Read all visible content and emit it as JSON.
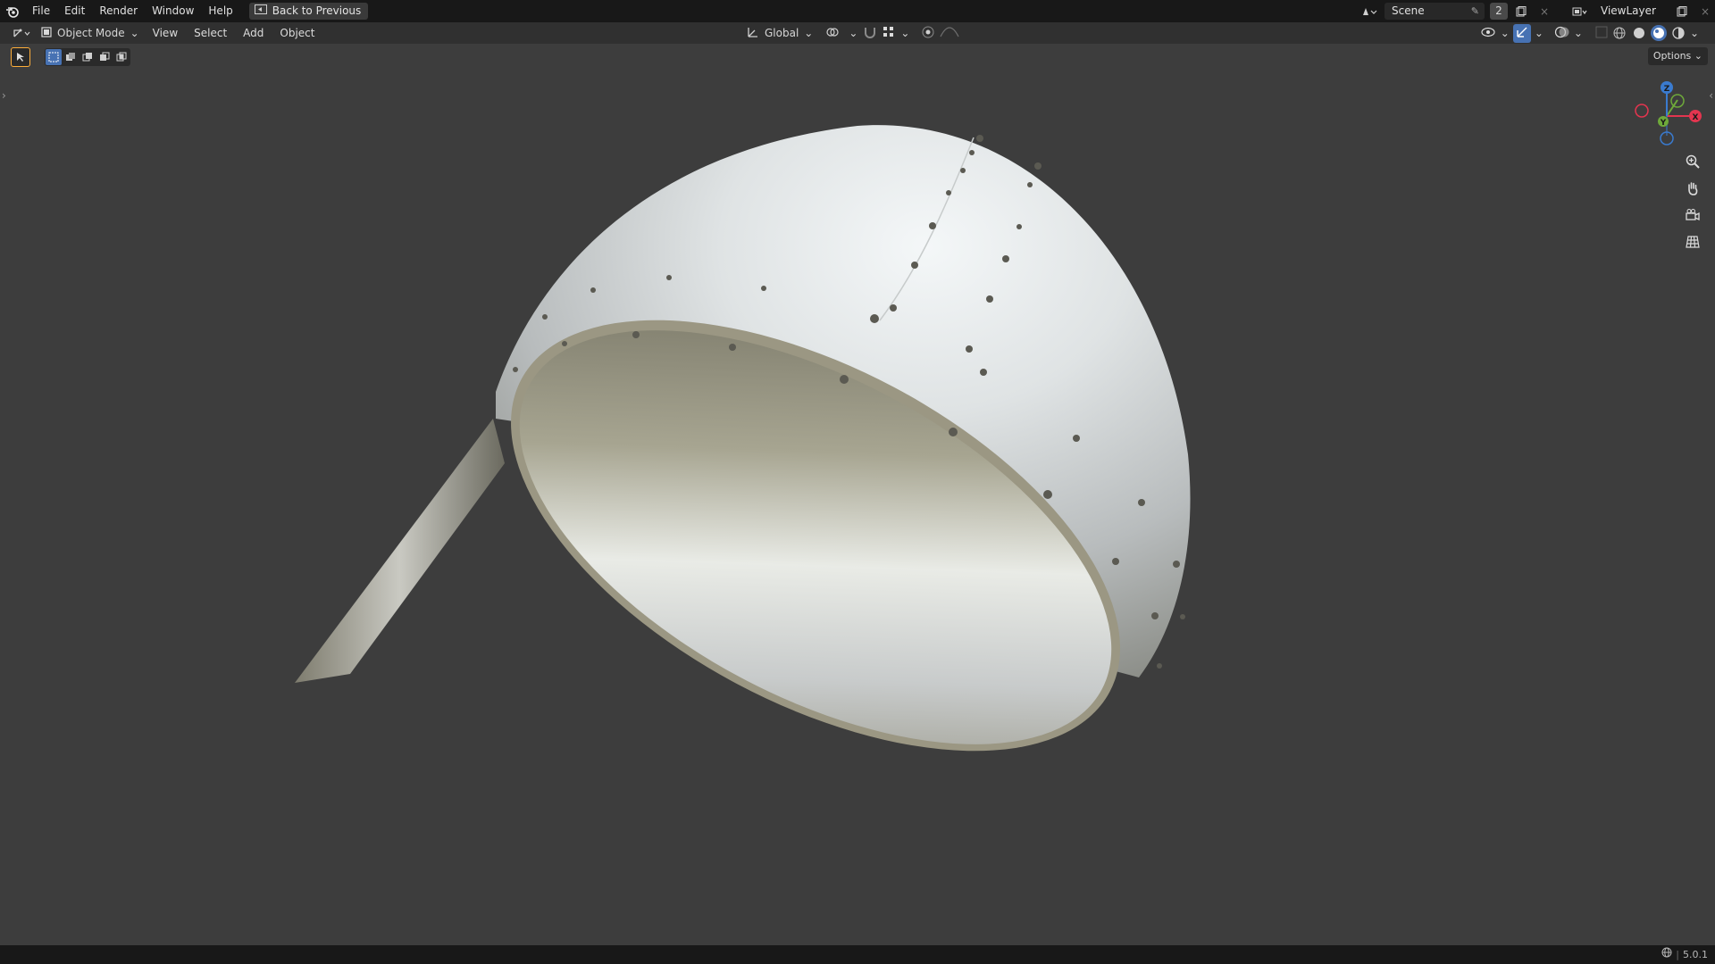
{
  "topbar": {
    "menus": [
      "File",
      "Edit",
      "Render",
      "Window",
      "Help"
    ],
    "back_label": "Back to Previous",
    "scene_name": "Scene",
    "scene_count": "2",
    "view_layer": "ViewLayer"
  },
  "header": {
    "mode_label": "Object Mode",
    "menus": [
      "View",
      "Select",
      "Add",
      "Object"
    ],
    "orientation_label": "Global",
    "options_label": "Options"
  },
  "gizmo": {
    "x_label": "X",
    "y_label": "Y",
    "z_label": "Z",
    "colors": {
      "x": "#e3354f",
      "y": "#6ea93a",
      "z": "#3a7bcf"
    }
  },
  "status": {
    "version": "5.0.1"
  },
  "icons": [
    "blender-logo-icon",
    "back-icon",
    "editor-type-icon",
    "object-mode-icon",
    "transform-orientation-icon",
    "pivot-icon",
    "snap-icon",
    "proportional-edit-icon",
    "visibility-icon",
    "gizmo-icon",
    "overlay-icon",
    "xray-icon",
    "wireframe-shading-icon",
    "solid-shading-icon",
    "material-shading-icon",
    "rendered-shading-icon",
    "zoom-icon",
    "pan-hand-icon",
    "camera-icon",
    "grid-icon",
    "select-cursor-icon"
  ],
  "viewport": {
    "background": "#3d3d3d",
    "object_description_colors": {
      "metal_highlight": "#e8ecef",
      "metal_mid": "#b5b9bb",
      "metal_shadow": "#6e6a58"
    }
  }
}
